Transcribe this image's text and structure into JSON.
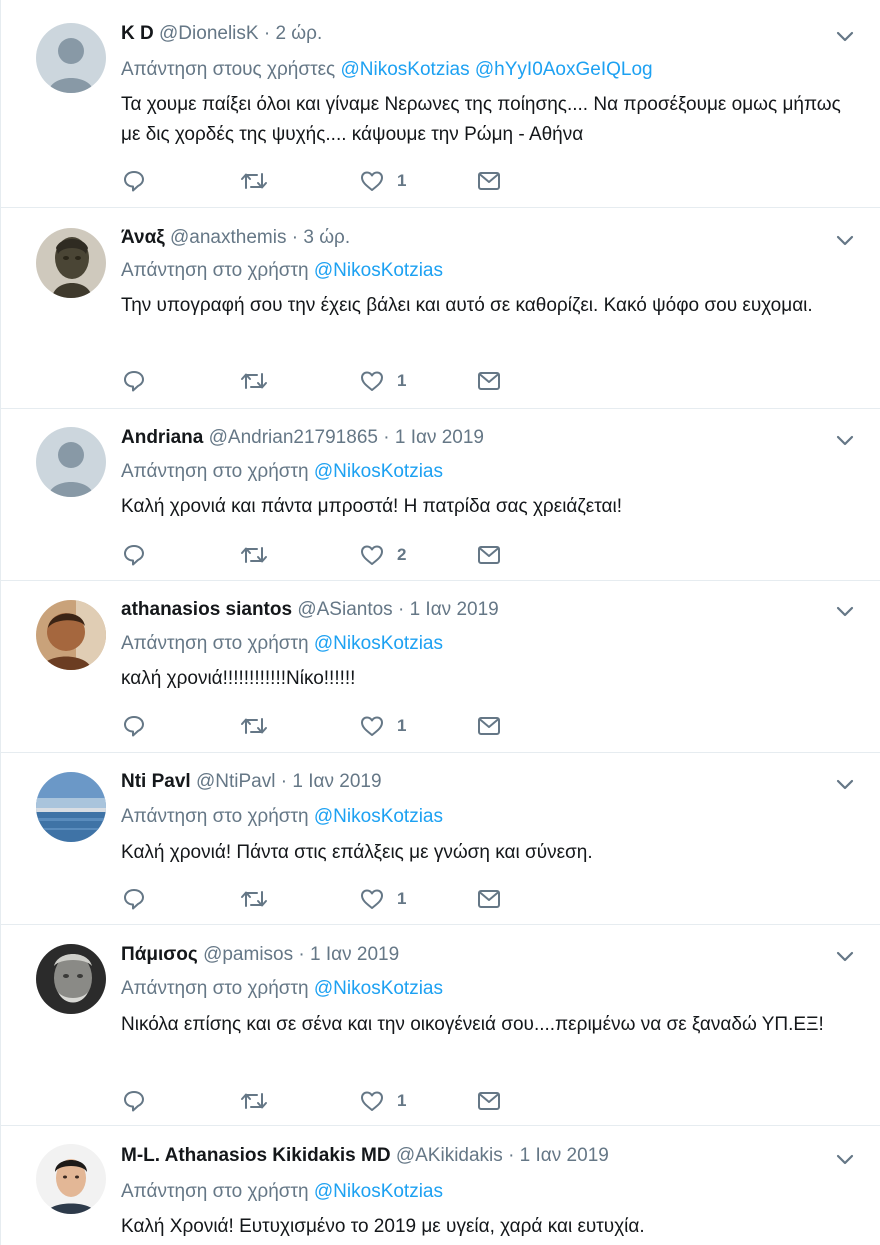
{
  "colors": {
    "link": "#1da1f2",
    "muted": "#657786",
    "text": "#14171a",
    "divider": "#e6ecf0"
  },
  "tweets": [
    {
      "name": "K D",
      "handle": "@DionelisK",
      "separator": "·",
      "time": "2 ώρ.",
      "reply_prefix": "Απάντηση στους χρήστες",
      "mentions": [
        "@NikosKotzias",
        "@hYyI0AoxGeIQLog"
      ],
      "text": "Τα χουμε παίξει όλοι και γίναμε Νερωνες της ποίησης.... Να προσέξουμε ομως μήπως με δις χορδές της  ψυχής.... κάψουμε την Ρώμη - Αθήνα",
      "likes": "1",
      "avatar": "default-avatar-icon"
    },
    {
      "name": "Άναξ",
      "handle": "@anaxthemis",
      "separator": "·",
      "time": "3 ώρ.",
      "reply_prefix": "Απάντηση στο χρήστη",
      "mentions": [
        "@NikosKotzias"
      ],
      "text": "Την υπογραφή σου την έχεις βάλει και αυτό σε καθορίζει. Κακό ψόφο σου ευχομαι.",
      "likes": "1",
      "avatar": "statue-photo"
    },
    {
      "name": "Andriana",
      "handle": "@Andrian21791865",
      "separator": "·",
      "time": "1 Ιαν 2019",
      "reply_prefix": "Απάντηση στο χρήστη",
      "mentions": [
        "@NikosKotzias"
      ],
      "text": "Καλή χρονιά και πάντα μπροστά! Η πατρίδα σας χρειάζεται!",
      "likes": "2",
      "avatar": "default-avatar-icon"
    },
    {
      "name": "athanasios siantos",
      "handle": "@ASiantos",
      "separator": "·",
      "time": "1 Ιαν 2019",
      "reply_prefix": "Απάντηση στο χρήστη",
      "mentions": [
        "@NikosKotzias"
      ],
      "text": "καλή χρονιά!!!!!!!!!!!!Νίκο!!!!!!",
      "likes": "1",
      "avatar": "person-photo"
    },
    {
      "name": "Nti Pavl",
      "handle": "@NtiPavl",
      "separator": "·",
      "time": "1 Ιαν 2019",
      "reply_prefix": "Απάντηση στο χρήστη",
      "mentions": [
        "@NikosKotzias"
      ],
      "text": "Καλή χρονιά! Πάντα στις επάλξεις με γνώση και σύνεση.",
      "likes": "1",
      "avatar": "seascape-photo"
    },
    {
      "name": "Πάμισος",
      "handle": "@pamisos",
      "separator": "·",
      "time": "1 Ιαν 2019",
      "reply_prefix": "Απάντηση στο χρήστη",
      "mentions": [
        "@NikosKotzias"
      ],
      "text": "Νικόλα επίσης και σε σένα και την οικογένειά σου....περιμένω να σε ξαναδώ ΥΠ.ΕΞ!",
      "likes": "1",
      "avatar": "old-man-photo"
    },
    {
      "name": "M-L. Athanasios Kikidakis MD",
      "handle": "@AKikidakis",
      "separator": "·",
      "time": "1 Ιαν 2019",
      "reply_prefix": "Απάντηση στο χρήστη",
      "mentions": [
        "@NikosKotzias"
      ],
      "text": "Καλή Χρονιά! Ευτυχισμένο το 2019 με υγεία, χαρά και ευτυχία.",
      "likes": "",
      "avatar": "man-portrait-photo"
    }
  ]
}
